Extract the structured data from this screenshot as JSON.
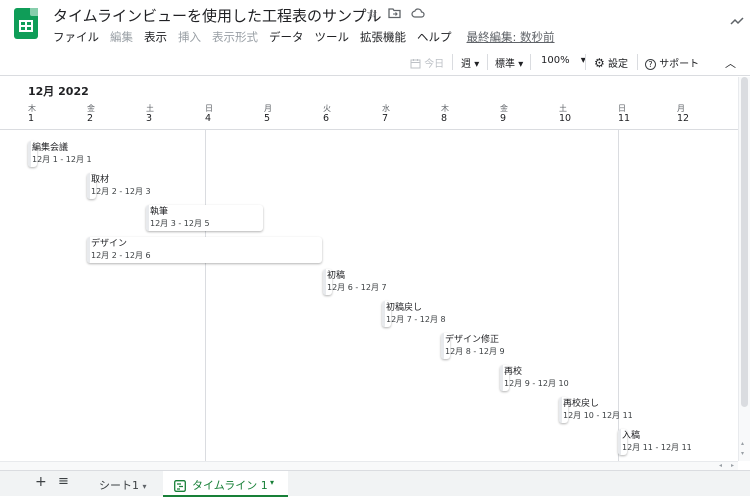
{
  "doc_title": "タイムラインビューを使用した工程表のサンプル",
  "menu": [
    {
      "label": "ファイル",
      "disabled": false
    },
    {
      "label": "編集",
      "disabled": true
    },
    {
      "label": "表示",
      "disabled": false
    },
    {
      "label": "挿入",
      "disabled": true
    },
    {
      "label": "表示形式",
      "disabled": true
    },
    {
      "label": "データ",
      "disabled": false
    },
    {
      "label": "ツール",
      "disabled": false
    },
    {
      "label": "拡張機能",
      "disabled": false
    },
    {
      "label": "ヘルプ",
      "disabled": false
    }
  ],
  "last_edit": "最終編集: 数秒前",
  "toolbar": {
    "today": "今日",
    "period": "週",
    "display": "標準",
    "zoom": "100%",
    "settings": "設定",
    "support": "サポート"
  },
  "timeline": {
    "month": "12月 2022",
    "days": [
      {
        "dow": "木",
        "num": "1"
      },
      {
        "dow": "金",
        "num": "2"
      },
      {
        "dow": "土",
        "num": "3"
      },
      {
        "dow": "日",
        "num": "4"
      },
      {
        "dow": "月",
        "num": "5"
      },
      {
        "dow": "火",
        "num": "6"
      },
      {
        "dow": "水",
        "num": "7"
      },
      {
        "dow": "木",
        "num": "8"
      },
      {
        "dow": "金",
        "num": "9"
      },
      {
        "dow": "土",
        "num": "10"
      },
      {
        "dow": "日",
        "num": "11"
      },
      {
        "dow": "月",
        "num": "12"
      }
    ],
    "tasks": [
      {
        "title": "編集会議",
        "dates": "12月 1 - 12月 1"
      },
      {
        "title": "取材",
        "dates": "12月 2 - 12月 3"
      },
      {
        "title": "執筆",
        "dates": "12月 3 - 12月 5"
      },
      {
        "title": "デザイン",
        "dates": "12月 2 - 12月 6"
      },
      {
        "title": "初稿",
        "dates": "12月 6 - 12月 7"
      },
      {
        "title": "初稿戻し",
        "dates": "12月 7 - 12月 8"
      },
      {
        "title": "デザイン修正",
        "dates": "12月 8 - 12月 9"
      },
      {
        "title": "再校",
        "dates": "12月 9 - 12月 10"
      },
      {
        "title": "再校戻し",
        "dates": "12月 10 - 12月 11"
      },
      {
        "title": "入稿",
        "dates": "12月 11 - 12月 11"
      }
    ]
  },
  "sheets": {
    "sheet1": "シート1",
    "timeline_tab": "タイムライン 1"
  },
  "colors": {
    "accent": "#188038",
    "logo": "#0f9d58"
  }
}
